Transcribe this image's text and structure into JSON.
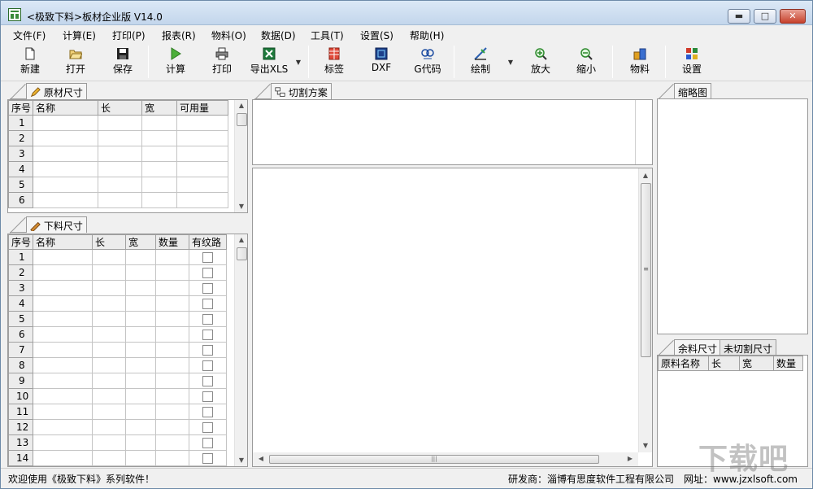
{
  "window": {
    "title": "<极致下料>板材企业版 V14.0",
    "controls": {
      "minimize": "▬",
      "maximize": "□",
      "close": "✕"
    }
  },
  "menu": [
    "文件(F)",
    "计算(E)",
    "打印(P)",
    "报表(R)",
    "物料(O)",
    "数据(D)",
    "工具(T)",
    "设置(S)",
    "帮助(H)"
  ],
  "toolbar": {
    "new": "新建",
    "open": "打开",
    "save": "保存",
    "calc": "计算",
    "print": "打印",
    "export_xls": "导出XLS",
    "label": "标签",
    "dxf": "DXF",
    "gcode": "G代码",
    "draw": "绘制",
    "zoom_in": "放大",
    "zoom_out": "缩小",
    "material": "物料",
    "settings": "设置"
  },
  "raw_panel": {
    "tab": "原材尺寸",
    "columns": [
      "序号",
      "名称",
      "长",
      "宽",
      "可用量"
    ],
    "rows": [
      "1",
      "2",
      "3",
      "4",
      "5",
      "6"
    ]
  },
  "cut_panel": {
    "tab": "下料尺寸",
    "columns": [
      "序号",
      "名称",
      "长",
      "宽",
      "数量",
      "有纹路"
    ],
    "rows": [
      "1",
      "2",
      "3",
      "4",
      "5",
      "6",
      "7",
      "8",
      "9",
      "10",
      "11",
      "12",
      "13",
      "14"
    ]
  },
  "plan_panel": {
    "tab": "切割方案"
  },
  "thumb_panel": {
    "tab": "缩略图"
  },
  "remain_panel": {
    "tabs": [
      "余料尺寸",
      "未切割尺寸"
    ],
    "columns": [
      "原料名称",
      "长",
      "宽",
      "数量"
    ]
  },
  "status": {
    "welcome": "欢迎使用《极致下料》系列软件！",
    "developer": "研发商：淄博有思度软件工程有限公司",
    "website": "网址：www.jzxlsoft.com"
  },
  "watermark": "下载吧"
}
